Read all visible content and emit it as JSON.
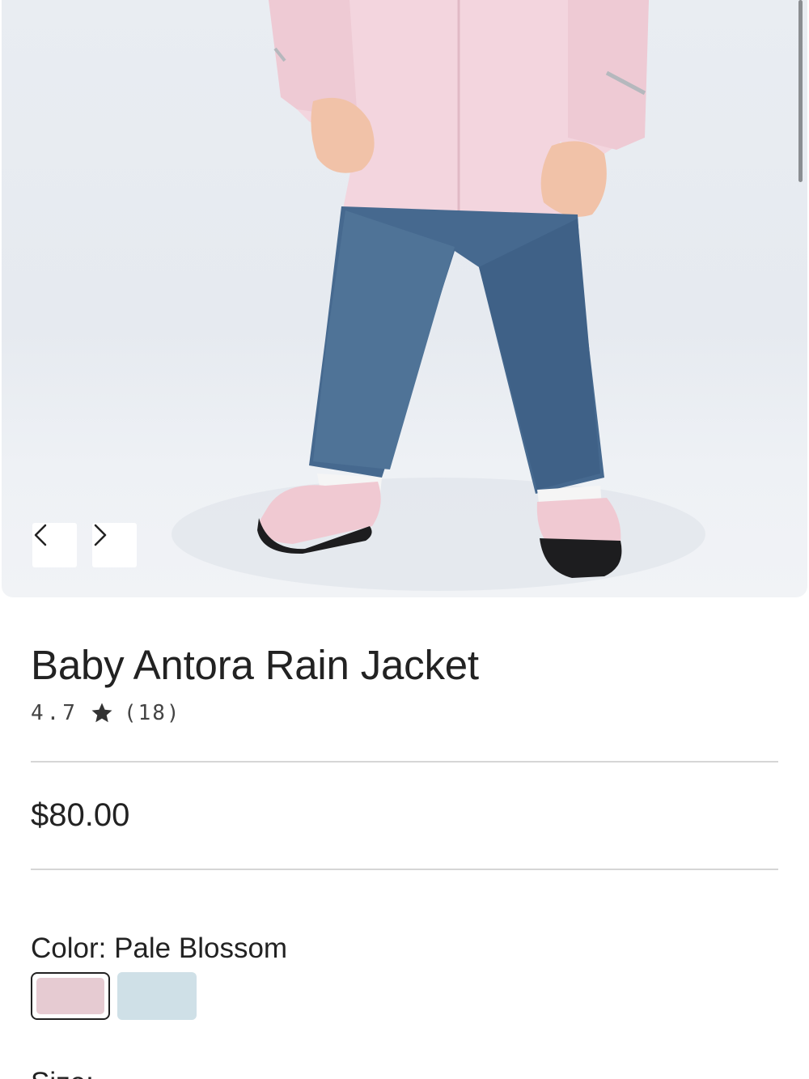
{
  "product": {
    "title": "Baby Antora Rain Jacket",
    "rating": "4.7",
    "review_count": "(18)",
    "price": "$80.00"
  },
  "gallery": {
    "prev_icon": "chevron-left-icon",
    "next_icon": "chevron-right-icon"
  },
  "color": {
    "label": "Color: Pale Blossom",
    "swatches": [
      {
        "name": "Pale Blossom",
        "hex": "#e6cbd2",
        "selected": true
      },
      {
        "name": "",
        "hex": "#cfe0e7",
        "selected": false
      }
    ]
  },
  "size": {
    "label": "Size:"
  },
  "icons": {
    "star": "star-icon"
  }
}
